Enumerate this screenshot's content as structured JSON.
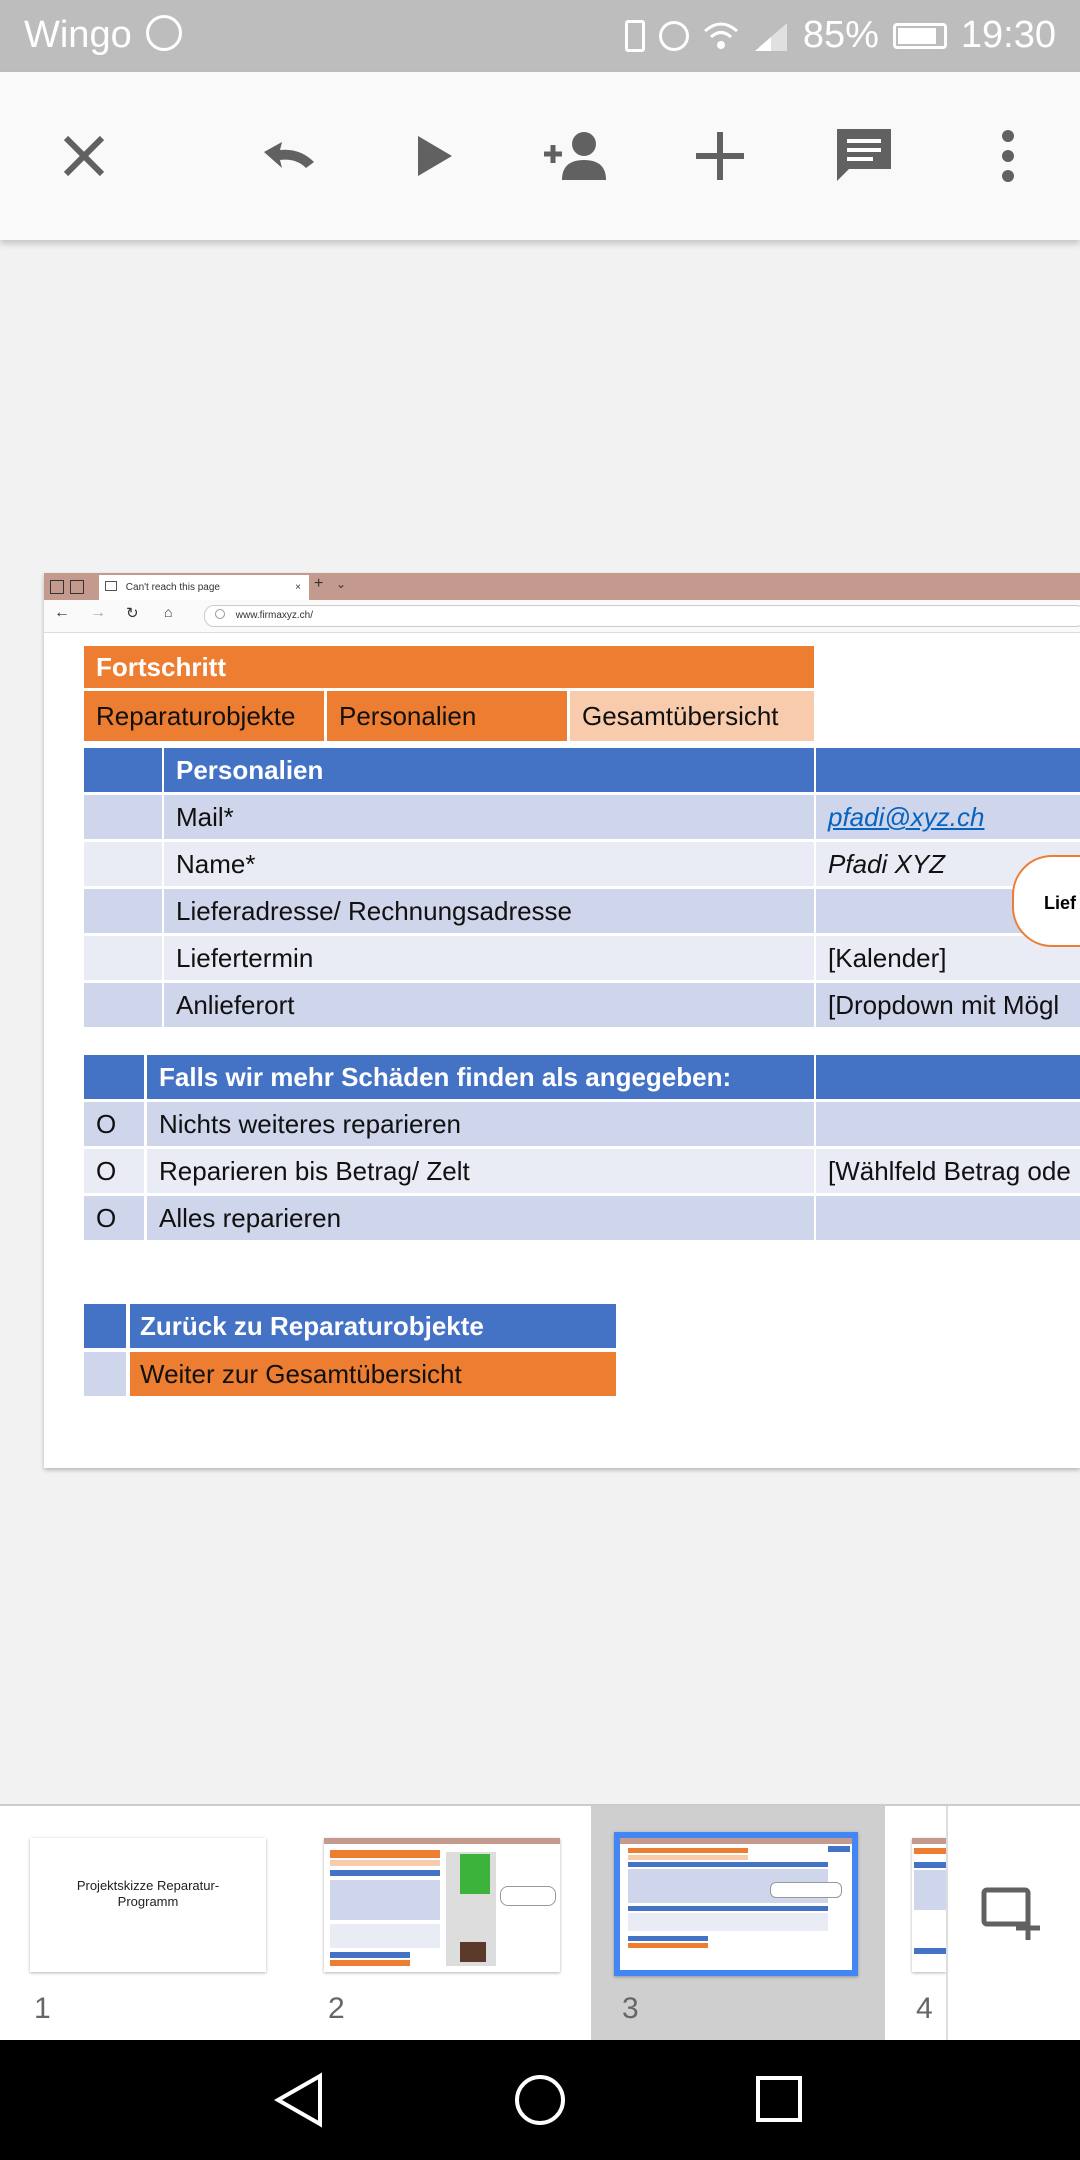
{
  "status_bar": {
    "carrier": "Wingo",
    "battery": "85%",
    "time": "19:30"
  },
  "toolbar": {
    "icons": [
      "close-icon",
      "undo-icon",
      "play-icon",
      "add-person-icon",
      "add-icon",
      "comment-icon",
      "more-vert-icon"
    ]
  },
  "browser": {
    "tab_title": "Can't reach this page",
    "url": "www.firmaxyz.ch/"
  },
  "progress": {
    "title": "Fortschritt",
    "steps": [
      "Reparaturobjekte",
      "Personalien",
      "Gesamtübersicht"
    ]
  },
  "personalien": {
    "header": "Personalien",
    "rows": [
      {
        "label": "Mail*",
        "value": "pfadi@xyz.ch"
      },
      {
        "label": "Name*",
        "value": "Pfadi XYZ"
      },
      {
        "label": "Lieferadresse/ Rechnungsadresse",
        "value": ""
      },
      {
        "label": "Liefertermin",
        "value": "[Kalender]"
      },
      {
        "label": "Anlieferort",
        "value": "[Dropdown mit Mögl"
      }
    ],
    "callout": "Lief"
  },
  "damage": {
    "header": "Falls wir mehr Schäden finden als angegeben:",
    "rows": [
      {
        "radio": "O",
        "label": "Nichts weiteres reparieren",
        "value": ""
      },
      {
        "radio": "O",
        "label": "Reparieren bis Betrag/ Zelt",
        "value": "[Wählfeld Betrag ode"
      },
      {
        "radio": "O",
        "label": "Alles reparieren",
        "value": ""
      }
    ]
  },
  "nav_buttons": {
    "back": "Zurück zu Reparaturobjekte",
    "next": "Weiter zur Gesamtübersicht"
  },
  "filmstrip": {
    "slides": [
      {
        "number": "1",
        "title": "Projektskizze Reparatur-Programm"
      },
      {
        "number": "2"
      },
      {
        "number": "3"
      },
      {
        "number": "4"
      }
    ],
    "add_slide_icon": "add-slide-icon"
  },
  "system_nav": {
    "icons": [
      "back-icon",
      "home-icon",
      "recents-icon"
    ]
  }
}
